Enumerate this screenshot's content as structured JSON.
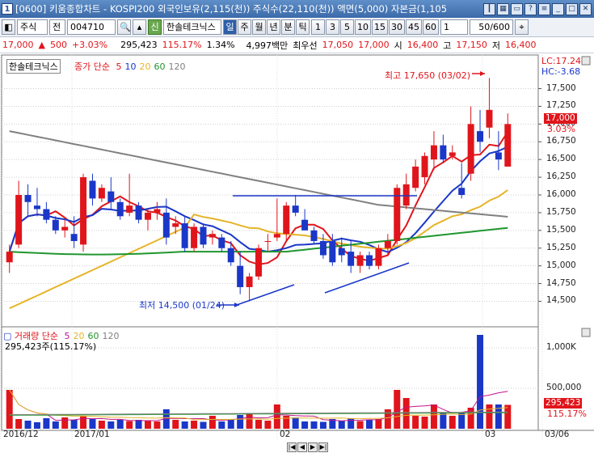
{
  "window": {
    "title": "[0600] 키움종합차트 - KOSPI200 외국인보유(2,115(천)) 주식수(22,110(천)) 액면(5,000) 자본금(1,105",
    "icon": "1",
    "controls": [
      "pin-icon",
      "chart-icon",
      "restore-icon",
      "help-icon",
      "menu-icon",
      "minimize-icon",
      "maximize-icon",
      "close-icon"
    ],
    "control_glyphs": [
      "┃",
      "▦",
      "▭",
      "?",
      "≡",
      "_",
      "□",
      "✕"
    ]
  },
  "toolbar": {
    "market": "주식",
    "type": "전",
    "code": "004710",
    "fav_label": "신",
    "name": "한솔테크닉스",
    "periods": [
      "일",
      "주",
      "월",
      "년",
      "분",
      "틱"
    ],
    "active_period": "일",
    "intervals": [
      "1",
      "3",
      "5",
      "10",
      "15",
      "30",
      "45",
      "60"
    ],
    "interval_value": "1",
    "count": "50",
    "count_total": "/600"
  },
  "quote": {
    "price": "17,000",
    "change_arrow": "▲",
    "change": "500",
    "change_pct": "+3.03%",
    "volume": "295,423",
    "vol_ratio": "115.17%",
    "turnover": "1.34%",
    "amount": "4,997백만",
    "pref_label": "최우선",
    "bid": "17,050",
    "ask": "17,000",
    "open_label": "시",
    "open": "16,400",
    "high_label": "고",
    "high": "17,150",
    "low_label": "저",
    "low": "16,400"
  },
  "price_panel": {
    "name_tag": "한솔테크닉스",
    "ma_title": "종가 단순",
    "ma_periods": [
      "5",
      "10",
      "20",
      "60",
      "120"
    ],
    "ma_colors": [
      "#e0151b",
      "#1a37c8",
      "#e6b428",
      "#20962f",
      "#808080"
    ],
    "lc_label": "LC:17.24",
    "hc_label": "HC:-3.68",
    "last_price": "17,000",
    "last_pct": "3.03%",
    "y_ticks": [
      "17,500",
      "17,250",
      "17,000",
      "16,750",
      "16,500",
      "16,250",
      "16,000",
      "15,750",
      "15,500",
      "15,250",
      "15,000",
      "14,750",
      "14,500"
    ],
    "high_annotation": "최고 17,650 (03/02)",
    "low_annotation": "최저 14,500 (01/24)"
  },
  "volume_panel": {
    "title": "거래량 단순",
    "ma_periods": [
      "5",
      "20",
      "60",
      "120"
    ],
    "ma_colors": [
      "#c0148c",
      "#e6b428",
      "#20962f",
      "#808080"
    ],
    "summary": "295,423주(115.17%)",
    "y_ticks": [
      "1,000K",
      "500,000"
    ],
    "last_volume": "295,423",
    "last_ratio": "115.17%"
  },
  "dates": [
    "2016/12",
    "2017/01",
    "02",
    "03",
    "03/06"
  ],
  "colors": {
    "up": "#e0151b",
    "down": "#1a37c8",
    "accent": "#2e5ea8"
  },
  "chart_data": {
    "type": "candlestick",
    "candles": [
      {
        "o": 15050,
        "h": 15300,
        "l": 14900,
        "c": 15200
      },
      {
        "o": 15300,
        "h": 16200,
        "l": 15250,
        "c": 16000
      },
      {
        "o": 16000,
        "h": 16150,
        "l": 15700,
        "c": 15900
      },
      {
        "o": 15850,
        "h": 16100,
        "l": 15700,
        "c": 15800
      },
      {
        "o": 15800,
        "h": 15900,
        "l": 15600,
        "c": 15650
      },
      {
        "o": 15650,
        "h": 15700,
        "l": 15450,
        "c": 15500
      },
      {
        "o": 15500,
        "h": 15650,
        "l": 15400,
        "c": 15550
      },
      {
        "o": 15450,
        "h": 15700,
        "l": 15250,
        "c": 15350
      },
      {
        "o": 15300,
        "h": 16300,
        "l": 15200,
        "c": 16250
      },
      {
        "o": 16200,
        "h": 16300,
        "l": 15850,
        "c": 15950
      },
      {
        "o": 15950,
        "h": 16150,
        "l": 15900,
        "c": 16100
      },
      {
        "o": 16050,
        "h": 16250,
        "l": 15800,
        "c": 15900
      },
      {
        "o": 15900,
        "h": 15950,
        "l": 15650,
        "c": 15700
      },
      {
        "o": 15750,
        "h": 16300,
        "l": 15700,
        "c": 15850
      },
      {
        "o": 15850,
        "h": 15900,
        "l": 15600,
        "c": 15650
      },
      {
        "o": 15650,
        "h": 15800,
        "l": 15500,
        "c": 15750
      },
      {
        "o": 15750,
        "h": 15900,
        "l": 15650,
        "c": 15800
      },
      {
        "o": 15750,
        "h": 15950,
        "l": 15300,
        "c": 15400
      },
      {
        "o": 15550,
        "h": 15700,
        "l": 15450,
        "c": 15600
      },
      {
        "o": 15600,
        "h": 15700,
        "l": 15200,
        "c": 15250
      },
      {
        "o": 15250,
        "h": 15600,
        "l": 15200,
        "c": 15550
      },
      {
        "o": 15550,
        "h": 15600,
        "l": 15250,
        "c": 15300
      },
      {
        "o": 15400,
        "h": 15500,
        "l": 15300,
        "c": 15450
      },
      {
        "o": 15400,
        "h": 15450,
        "l": 15200,
        "c": 15250
      },
      {
        "o": 15250,
        "h": 15350,
        "l": 15000,
        "c": 15050
      },
      {
        "o": 15000,
        "h": 15200,
        "l": 14600,
        "c": 14700
      },
      {
        "o": 14700,
        "h": 14900,
        "l": 14500,
        "c": 14850
      },
      {
        "o": 14850,
        "h": 15300,
        "l": 14800,
        "c": 15250
      },
      {
        "o": 15350,
        "h": 15450,
        "l": 15200,
        "c": 15350
      },
      {
        "o": 15400,
        "h": 15950,
        "l": 15350,
        "c": 15450
      },
      {
        "o": 15450,
        "h": 15900,
        "l": 15350,
        "c": 15850
      },
      {
        "o": 15850,
        "h": 16000,
        "l": 15700,
        "c": 15750
      },
      {
        "o": 15650,
        "h": 15800,
        "l": 15550,
        "c": 15500
      },
      {
        "o": 15500,
        "h": 15550,
        "l": 15300,
        "c": 15350
      },
      {
        "o": 15350,
        "h": 15450,
        "l": 15100,
        "c": 15150
      },
      {
        "o": 15350,
        "h": 15450,
        "l": 15000,
        "c": 15050
      },
      {
        "o": 15250,
        "h": 15400,
        "l": 15050,
        "c": 15150
      },
      {
        "o": 15200,
        "h": 15350,
        "l": 14900,
        "c": 15000
      },
      {
        "o": 15000,
        "h": 15200,
        "l": 14900,
        "c": 15150
      },
      {
        "o": 15150,
        "h": 15200,
        "l": 14950,
        "c": 15000
      },
      {
        "o": 15000,
        "h": 15300,
        "l": 14950,
        "c": 15250
      },
      {
        "o": 15250,
        "h": 15450,
        "l": 15150,
        "c": 15350
      },
      {
        "o": 15350,
        "h": 16150,
        "l": 15300,
        "c": 16100
      },
      {
        "o": 15850,
        "h": 16300,
        "l": 15800,
        "c": 16150
      },
      {
        "o": 16100,
        "h": 16500,
        "l": 16050,
        "c": 16400
      },
      {
        "o": 16250,
        "h": 16600,
        "l": 16150,
        "c": 16550
      },
      {
        "o": 16500,
        "h": 16900,
        "l": 16350,
        "c": 16700
      },
      {
        "o": 16700,
        "h": 16850,
        "l": 16450,
        "c": 16500
      },
      {
        "o": 16550,
        "h": 16700,
        "l": 16500,
        "c": 16600
      },
      {
        "o": 16100,
        "h": 16450,
        "l": 15950,
        "c": 16000
      },
      {
        "o": 16300,
        "h": 17250,
        "l": 16200,
        "c": 17000
      },
      {
        "o": 16900,
        "h": 17200,
        "l": 16600,
        "c": 16750
      },
      {
        "o": 16950,
        "h": 17650,
        "l": 16800,
        "c": 17200
      },
      {
        "o": 16600,
        "h": 16900,
        "l": 16350,
        "c": 16500
      },
      {
        "o": 16400,
        "h": 17150,
        "l": 16400,
        "c": 17000
      }
    ],
    "volume": [
      480,
      120,
      100,
      80,
      130,
      90,
      140,
      110,
      160,
      120,
      100,
      90,
      110,
      95,
      110,
      95,
      90,
      240,
      110,
      90,
      100,
      85,
      160,
      90,
      120,
      170,
      180,
      110,
      100,
      300,
      160,
      140,
      90,
      90,
      85,
      120,
      100,
      130,
      95,
      110,
      120,
      240,
      480,
      380,
      160,
      150,
      300,
      200,
      160,
      200,
      260,
      1160,
      300,
      300,
      295
    ],
    "ylim": [
      14300,
      17700
    ],
    "volume_ylim": [
      0,
      1200
    ]
  }
}
